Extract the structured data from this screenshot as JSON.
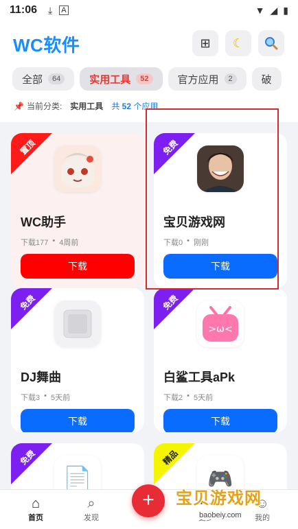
{
  "status": {
    "time": "11:06"
  },
  "header": {
    "title": "WC软件",
    "grid_icon": "grid-icon",
    "theme_icon": "moon-icon",
    "search_icon": "search-icon"
  },
  "tabs": [
    {
      "label": "全部",
      "count": "64"
    },
    {
      "label": "实用工具",
      "count": "52"
    },
    {
      "label": "官方应用",
      "count": "2"
    },
    {
      "label": "破",
      "count": ""
    }
  ],
  "category": {
    "prefix": "当前分类:",
    "current": "实用工具",
    "total_pre": "共",
    "total_num": "52",
    "total_suf": "个应用"
  },
  "cards": [
    {
      "badge": "置顶",
      "name": "WC助手",
      "downloads": "下载177",
      "time": "4周前",
      "button": "下载"
    },
    {
      "badge": "免费",
      "name": "宝贝游戏网",
      "downloads": "下载0",
      "time": "刚刚",
      "button": "下载"
    },
    {
      "badge": "免费",
      "name": "DJ舞曲",
      "downloads": "下载3",
      "time": "5天前",
      "button": "下载"
    },
    {
      "badge": "免费",
      "name": "白鲨工具aPk",
      "downloads": "下载2",
      "time": "5天前",
      "button": "下载"
    },
    {
      "badge": "免费",
      "name": "",
      "downloads": "",
      "time": "",
      "button": ""
    },
    {
      "badge": "精品",
      "name": "",
      "downloads": "",
      "time": "",
      "button": ""
    }
  ],
  "nav": {
    "home": "首页",
    "discover": "发现",
    "more": "更多",
    "mine": "我的",
    "fab": "+"
  },
  "watermark": {
    "main": "宝贝游戏网",
    "sub": "baobeiy.com"
  },
  "colors": {
    "accent": "#1a8cff",
    "danger": "#e53935",
    "button_blue": "#0a6cff",
    "ribbon_purple": "#7c1ff0"
  }
}
